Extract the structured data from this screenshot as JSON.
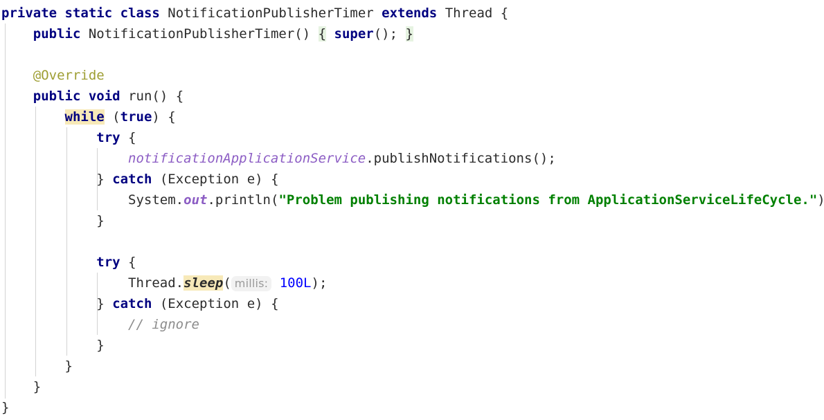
{
  "editor": {
    "language": "java",
    "font_size_px": 19,
    "line_height_px": 30,
    "background": "#ffffff",
    "colors": {
      "keyword": "#000080",
      "identifier": "#2b2b2b",
      "string": "#008000",
      "number": "#0000ff",
      "annotation": "#9e9e33",
      "field": "#8c5dc4",
      "comment": "#8c8c8c",
      "inlay_hint_text": "#9a9a9a",
      "inlay_hint_background": "#f2f2f2",
      "search_highlight": "#f7e9b8",
      "brace_match_highlight": "#e6f3e1",
      "indent_guide": "#d3d3d3"
    }
  },
  "code": {
    "line01": {
      "kw_private": "private",
      "sp1": " ",
      "kw_static": "static",
      "sp2": " ",
      "kw_class": "class",
      "sp3": " ",
      "class_name": "NotificationPublisherTimer",
      "sp4": " ",
      "kw_extends": "extends",
      "sp5": " ",
      "super_type": "Thread",
      "sp6": " ",
      "open_brace": "{"
    },
    "line02": {
      "indent": "    ",
      "kw_public": "public",
      "sp1": " ",
      "ctor_name": "NotificationPublisherTimer",
      "parens": "()",
      "sp2": " ",
      "open_brace": "{",
      "sp3": " ",
      "kw_super": "super",
      "call": "();",
      "sp4": " ",
      "close_brace": "}"
    },
    "line03": {
      "text": ""
    },
    "line04": {
      "indent": "    ",
      "annotation": "@Override"
    },
    "line05": {
      "indent": "    ",
      "kw_public": "public",
      "sp1": " ",
      "kw_void": "void",
      "sp2": " ",
      "method_name": "run",
      "parens": "()",
      "sp3": " ",
      "open_brace": "{"
    },
    "line06": {
      "indent": "        ",
      "kw_while": "while",
      "sp1": " ",
      "paren_open": "(",
      "kw_true": "true",
      "paren_close": ")",
      "sp2": " ",
      "open_brace": "{"
    },
    "line07": {
      "indent": "            ",
      "kw_try": "try",
      "sp1": " ",
      "open_brace": "{"
    },
    "line08": {
      "indent": "                ",
      "field": "notificationApplicationService",
      "dot": ".",
      "method": "publishNotifications",
      "tail": "();"
    },
    "line09": {
      "indent": "            ",
      "close_brace": "}",
      "sp1": " ",
      "kw_catch": "catch",
      "sp2": " ",
      "paren_open": "(",
      "exception_type": "Exception",
      "sp3": " ",
      "var": "e",
      "paren_close": ")",
      "sp4": " ",
      "open_brace": "{"
    },
    "line10": {
      "indent": "                ",
      "system": "System",
      "dot1": ".",
      "out": "out",
      "dot2": ".",
      "println": "println",
      "paren_open": "(",
      "string": "\"Problem publishing notifications from ApplicationServiceLifeCycle.\"",
      "tail": ");"
    },
    "line11": {
      "indent": "            ",
      "close_brace": "}"
    },
    "line12": {
      "text": ""
    },
    "line13": {
      "indent": "            ",
      "kw_try": "try",
      "sp1": " ",
      "open_brace": "{"
    },
    "line14": {
      "indent": "                ",
      "thread": "Thread",
      "dot": ".",
      "sleep": "sleep",
      "paren_open": "(",
      "inlay_hint": "millis:",
      "sp1": " ",
      "number": "100L",
      "tail": ");"
    },
    "line15": {
      "indent": "            ",
      "close_brace": "}",
      "sp1": " ",
      "kw_catch": "catch",
      "sp2": " ",
      "paren_open": "(",
      "exception_type": "Exception",
      "sp3": " ",
      "var": "e",
      "paren_close": ")",
      "sp4": " ",
      "open_brace": "{"
    },
    "line16": {
      "indent": "                ",
      "comment": "// ignore"
    },
    "line17": {
      "indent": "            ",
      "close_brace": "}"
    },
    "line18": {
      "indent": "        ",
      "close_brace": "}"
    },
    "line19": {
      "indent": "    ",
      "close_brace": "}"
    },
    "line20": {
      "close_brace": "}"
    }
  }
}
